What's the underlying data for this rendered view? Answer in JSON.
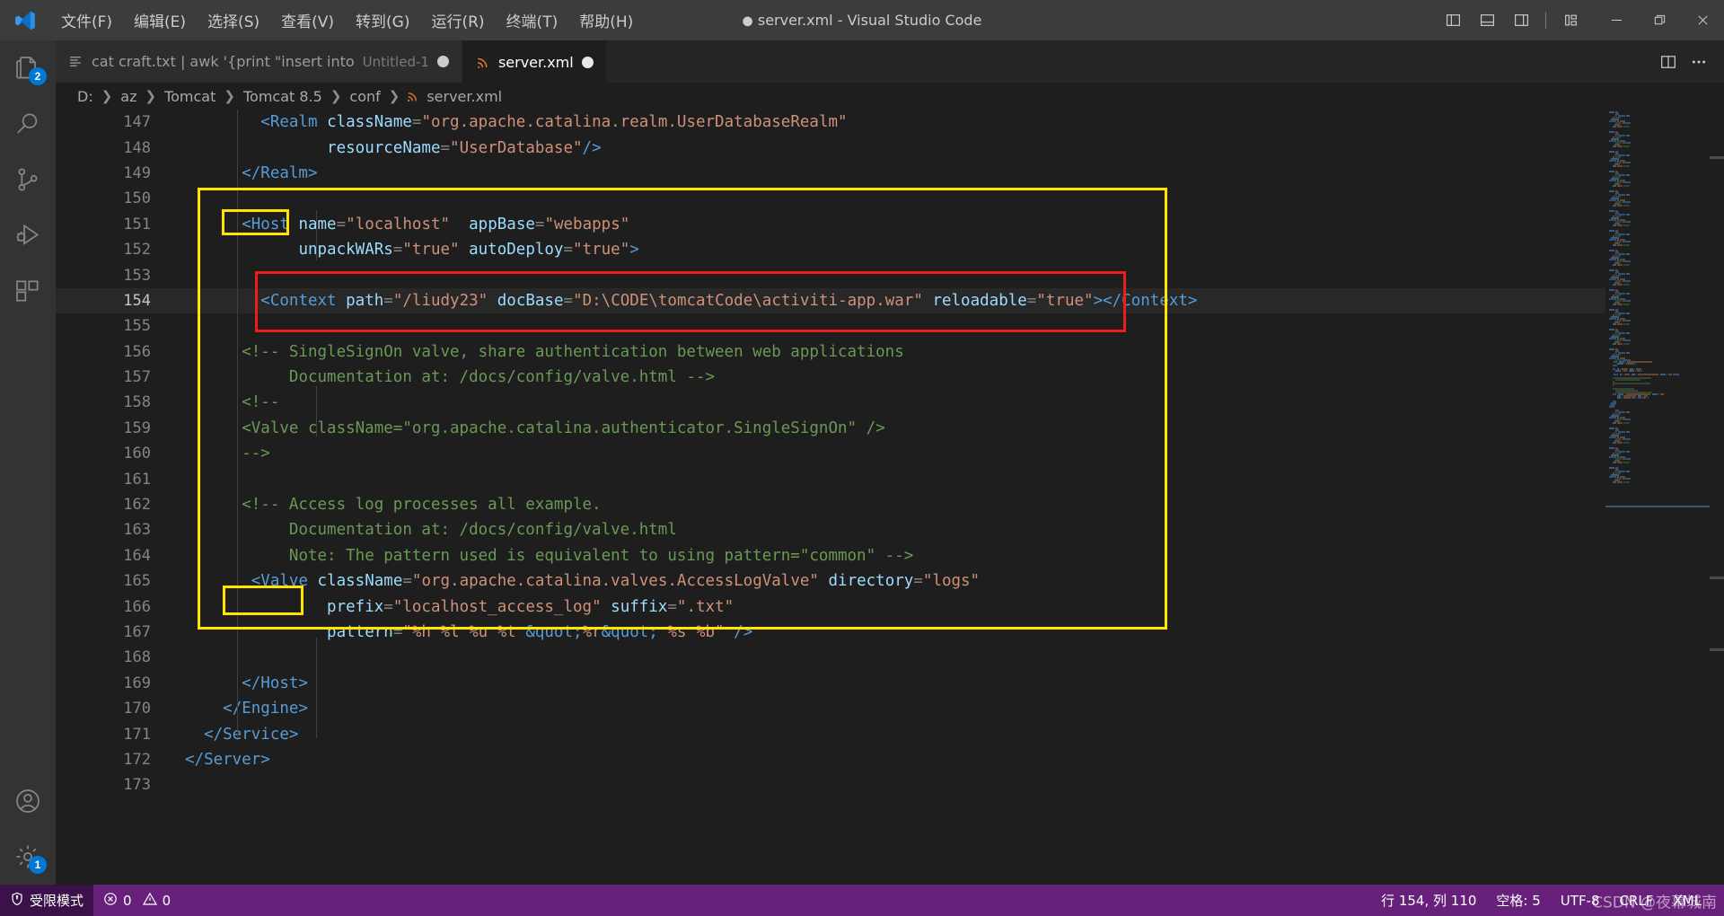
{
  "titlebar": {
    "menu": [
      "文件(F)",
      "编辑(E)",
      "选择(S)",
      "查看(V)",
      "转到(G)",
      "运行(R)",
      "终端(T)",
      "帮助(H)"
    ],
    "window_title": "server.xml - Visual Studio Code",
    "dirty_marker": "●",
    "controls": {
      "toggle_primary_sidebar": "toggle-primary-sidebar",
      "toggle_panel": "toggle-panel",
      "toggle_secondary_sidebar": "toggle-secondary-sidebar",
      "customize_layout": "customize-layout",
      "minimize": "minimize",
      "restore": "restore",
      "close": "close"
    }
  },
  "activitybar": {
    "items": [
      {
        "name": "explorer",
        "icon": "files-icon",
        "badge": "2",
        "active": false
      },
      {
        "name": "search",
        "icon": "search-icon",
        "badge": "",
        "active": false
      },
      {
        "name": "source-control",
        "icon": "source-control-icon",
        "badge": "",
        "active": false
      },
      {
        "name": "run-and-debug",
        "icon": "run-debug-icon",
        "badge": "",
        "active": false
      },
      {
        "name": "extensions",
        "icon": "extensions-icon",
        "badge": "",
        "active": false
      }
    ],
    "bottom": [
      {
        "name": "accounts",
        "icon": "account-icon",
        "badge": ""
      },
      {
        "name": "manage",
        "icon": "gear-icon",
        "badge": "1"
      }
    ]
  },
  "tabs": [
    {
      "title": "cat craft.txt | awk '{print \"insert into",
      "description": "Untitled-1",
      "icon": "terminal-icon",
      "dirty": true,
      "active": false
    },
    {
      "title": "server.xml",
      "description": "",
      "icon": "xml-icon",
      "dirty": true,
      "active": true
    }
  ],
  "editor_actions": {
    "split_editor": "split-editor",
    "more_actions": "more-actions"
  },
  "breadcrumbs": [
    {
      "label": "D:",
      "icon": ""
    },
    {
      "label": "az",
      "icon": ""
    },
    {
      "label": "Tomcat",
      "icon": ""
    },
    {
      "label": "Tomcat 8.5",
      "icon": ""
    },
    {
      "label": "conf",
      "icon": ""
    },
    {
      "label": "server.xml",
      "icon": "xml-icon"
    }
  ],
  "code": {
    "first_line": 147,
    "current_line": 154,
    "lines": [
      {
        "n": 147,
        "tokens": [
          {
            "t": "plain",
            "v": "        "
          },
          {
            "t": "tag",
            "v": "<Realm"
          },
          {
            "t": "plain",
            "v": " "
          },
          {
            "t": "attr",
            "v": "className"
          },
          {
            "t": "plain",
            "v": "="
          },
          {
            "t": "str",
            "v": "\"org.apache.catalina.realm.UserDatabaseRealm\""
          }
        ]
      },
      {
        "n": 148,
        "tokens": [
          {
            "t": "plain",
            "v": "               "
          },
          {
            "t": "attr",
            "v": "resourceName"
          },
          {
            "t": "plain",
            "v": "="
          },
          {
            "t": "str",
            "v": "\"UserDatabase\""
          },
          {
            "t": "tag",
            "v": "/>"
          }
        ]
      },
      {
        "n": 149,
        "tokens": [
          {
            "t": "plain",
            "v": "      "
          },
          {
            "t": "tag",
            "v": "</Realm>"
          }
        ]
      },
      {
        "n": 150,
        "tokens": []
      },
      {
        "n": 151,
        "tokens": [
          {
            "t": "plain",
            "v": "      "
          },
          {
            "t": "tag",
            "v": "<Host"
          },
          {
            "t": "plain",
            "v": " "
          },
          {
            "t": "attr",
            "v": "name"
          },
          {
            "t": "plain",
            "v": "="
          },
          {
            "t": "str",
            "v": "\"localhost\""
          },
          {
            "t": "plain",
            "v": "  "
          },
          {
            "t": "attr",
            "v": "appBase"
          },
          {
            "t": "plain",
            "v": "="
          },
          {
            "t": "str",
            "v": "\"webapps\""
          }
        ]
      },
      {
        "n": 152,
        "tokens": [
          {
            "t": "plain",
            "v": "            "
          },
          {
            "t": "attr",
            "v": "unpackWARs"
          },
          {
            "t": "plain",
            "v": "="
          },
          {
            "t": "str",
            "v": "\"true\""
          },
          {
            "t": "plain",
            "v": " "
          },
          {
            "t": "attr",
            "v": "autoDeploy"
          },
          {
            "t": "plain",
            "v": "="
          },
          {
            "t": "str",
            "v": "\"true\""
          },
          {
            "t": "tag",
            "v": ">"
          }
        ]
      },
      {
        "n": 153,
        "tokens": []
      },
      {
        "n": 154,
        "tokens": [
          {
            "t": "plain",
            "v": "        "
          },
          {
            "t": "tag",
            "v": "<Context"
          },
          {
            "t": "plain",
            "v": " "
          },
          {
            "t": "attr",
            "v": "path"
          },
          {
            "t": "plain",
            "v": "="
          },
          {
            "t": "str",
            "v": "\"/liudy23\""
          },
          {
            "t": "plain",
            "v": " "
          },
          {
            "t": "attr",
            "v": "docBase"
          },
          {
            "t": "plain",
            "v": "="
          },
          {
            "t": "str",
            "v": "\"D:\\CODE\\tomcatCode\\activiti-app.war\""
          },
          {
            "t": "plain",
            "v": " "
          },
          {
            "t": "attr",
            "v": "reloadable"
          },
          {
            "t": "plain",
            "v": "="
          },
          {
            "t": "str",
            "v": "\"true\""
          },
          {
            "t": "tag",
            "v": "></Context>"
          }
        ]
      },
      {
        "n": 155,
        "tokens": []
      },
      {
        "n": 156,
        "tokens": [
          {
            "t": "plain",
            "v": "      "
          },
          {
            "t": "cmt",
            "v": "<!-- SingleSignOn valve, share authentication between web applications"
          }
        ]
      },
      {
        "n": 157,
        "tokens": [
          {
            "t": "plain",
            "v": "           "
          },
          {
            "t": "cmt",
            "v": "Documentation at: /docs/config/valve.html -->"
          }
        ]
      },
      {
        "n": 158,
        "tokens": [
          {
            "t": "plain",
            "v": "      "
          },
          {
            "t": "cmt",
            "v": "<!--"
          }
        ]
      },
      {
        "n": 159,
        "tokens": [
          {
            "t": "plain",
            "v": "      "
          },
          {
            "t": "cmt",
            "v": "<Valve className=\"org.apache.catalina.authenticator.SingleSignOn\" />"
          }
        ]
      },
      {
        "n": 160,
        "tokens": [
          {
            "t": "plain",
            "v": "      "
          },
          {
            "t": "cmt",
            "v": "-->"
          }
        ]
      },
      {
        "n": 161,
        "tokens": []
      },
      {
        "n": 162,
        "tokens": [
          {
            "t": "plain",
            "v": "      "
          },
          {
            "t": "cmt",
            "v": "<!-- Access log processes all example."
          }
        ]
      },
      {
        "n": 163,
        "tokens": [
          {
            "t": "plain",
            "v": "           "
          },
          {
            "t": "cmt",
            "v": "Documentation at: /docs/config/valve.html"
          }
        ]
      },
      {
        "n": 164,
        "tokens": [
          {
            "t": "plain",
            "v": "           "
          },
          {
            "t": "cmt",
            "v": "Note: The pattern used is equivalent to using pattern=\"common\" -->"
          }
        ]
      },
      {
        "n": 165,
        "tokens": [
          {
            "t": "plain",
            "v": "       "
          },
          {
            "t": "tag",
            "v": "<Valve"
          },
          {
            "t": "plain",
            "v": " "
          },
          {
            "t": "attr",
            "v": "className"
          },
          {
            "t": "plain",
            "v": "="
          },
          {
            "t": "str",
            "v": "\"org.apache.catalina.valves.AccessLogValve\""
          },
          {
            "t": "plain",
            "v": " "
          },
          {
            "t": "attr",
            "v": "directory"
          },
          {
            "t": "plain",
            "v": "="
          },
          {
            "t": "str",
            "v": "\"logs\""
          }
        ]
      },
      {
        "n": 166,
        "tokens": [
          {
            "t": "plain",
            "v": "               "
          },
          {
            "t": "attr",
            "v": "prefix"
          },
          {
            "t": "plain",
            "v": "="
          },
          {
            "t": "str",
            "v": "\"localhost_access_log\""
          },
          {
            "t": "plain",
            "v": " "
          },
          {
            "t": "attr",
            "v": "suffix"
          },
          {
            "t": "plain",
            "v": "="
          },
          {
            "t": "str",
            "v": "\".txt\""
          }
        ]
      },
      {
        "n": 167,
        "tokens": [
          {
            "t": "plain",
            "v": "               "
          },
          {
            "t": "attr",
            "v": "pattern"
          },
          {
            "t": "plain",
            "v": "="
          },
          {
            "t": "str",
            "v": "\"%h %l %u %t "
          },
          {
            "t": "ent",
            "v": "&quot;"
          },
          {
            "t": "str",
            "v": "%r"
          },
          {
            "t": "ent",
            "v": "&quot;"
          },
          {
            "t": "str",
            "v": " %s %b\""
          },
          {
            "t": "plain",
            "v": " "
          },
          {
            "t": "tag",
            "v": "/>"
          }
        ]
      },
      {
        "n": 168,
        "tokens": []
      },
      {
        "n": 169,
        "tokens": [
          {
            "t": "plain",
            "v": "      "
          },
          {
            "t": "tag",
            "v": "</Host>"
          }
        ]
      },
      {
        "n": 170,
        "tokens": [
          {
            "t": "plain",
            "v": "    "
          },
          {
            "t": "tag",
            "v": "</Engine>"
          }
        ]
      },
      {
        "n": 171,
        "tokens": [
          {
            "t": "plain",
            "v": "  "
          },
          {
            "t": "tag",
            "v": "</Service>"
          }
        ]
      },
      {
        "n": 172,
        "tokens": [
          {
            "t": "tag",
            "v": "</Server>"
          }
        ]
      },
      {
        "n": 173,
        "tokens": []
      }
    ],
    "annotations": [
      {
        "name": "host-block-highlight",
        "shape": "rect",
        "color": "#ffe400"
      },
      {
        "name": "host-open-tag-highlight",
        "shape": "rect",
        "color": "#ffe400"
      },
      {
        "name": "host-close-tag-highlight",
        "shape": "rect",
        "color": "#ffe400"
      },
      {
        "name": "context-line-highlight",
        "shape": "rect",
        "color": "#f01b1b"
      }
    ]
  },
  "statusbar": {
    "left": [
      {
        "name": "trust",
        "icon": "shield-icon",
        "label": "受限模式"
      },
      {
        "name": "problems",
        "icon": "error-warning-icon",
        "errors": "0",
        "warnings": "0"
      }
    ],
    "right": [
      {
        "name": "cursor-position",
        "label": "行 154, 列 110"
      },
      {
        "name": "indentation",
        "label": "空格: 5"
      },
      {
        "name": "encoding",
        "label": "UTF-8"
      },
      {
        "name": "eol",
        "label": "CRLF"
      },
      {
        "name": "language-mode",
        "label": "XML"
      }
    ],
    "watermark": "CSDN @夜幕城南"
  },
  "colors": {
    "accent": "#0078d4",
    "statusbar_bg": "#68217a",
    "editor_bg": "#1e1e1e",
    "tag": "#569cd6",
    "attr": "#9cdcfe",
    "string": "#ce9178",
    "comment": "#6a9955",
    "highlight_yellow": "#ffe400",
    "highlight_red": "#f01b1b"
  }
}
